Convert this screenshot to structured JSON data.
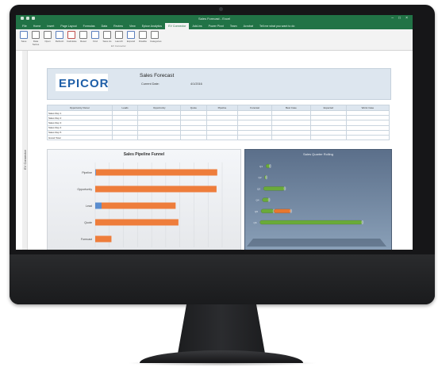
{
  "window": {
    "title": "Sales Forecast - Excel"
  },
  "ribbon": {
    "tabs": [
      "File",
      "Home",
      "Insert",
      "Page Layout",
      "Formulas",
      "Data",
      "Review",
      "View",
      "Epicor Analytics",
      "EV Connector",
      "Add-ins",
      "Power Pivot",
      "Team",
      "Acrobat",
      "Tell me what you want to do"
    ],
    "active_tab": "EV Connector",
    "buttons": [
      "Save",
      "Data Series",
      "Open",
      "Refresh",
      "Calculate",
      "Reset",
      "Find",
      "Save As",
      "Launch",
      "Expand",
      "Disable",
      "Categories"
    ],
    "group_label": "EV Connector"
  },
  "sidebar_label": "EV Connector",
  "report": {
    "logo": "EPICOR",
    "title": "Sales Forecast",
    "subtitle": "Current Date:",
    "date": "4/1/2016"
  },
  "table": {
    "headers": [
      "Opportunity Owner",
      "Leads",
      "Opportunity",
      "Quote",
      "Pipeline",
      "Forecast",
      "Best Case",
      "Expected",
      "Worst Case"
    ],
    "rows": [
      [
        "Sales Rep 1",
        "",
        "",
        "",
        "",
        "",
        "",
        "",
        ""
      ],
      [
        "Sales Rep 2",
        "",
        "",
        "",
        "",
        "",
        "",
        "",
        ""
      ],
      [
        "Sales Rep 3",
        "",
        "",
        "",
        "",
        "",
        "",
        "",
        ""
      ],
      [
        "Sales Rep 4",
        "",
        "",
        "",
        "",
        "",
        "",
        "",
        ""
      ],
      [
        "Sales Rep 5",
        "",
        "",
        "",
        "",
        "",
        "",
        "",
        ""
      ],
      [
        "Grand Total",
        "",
        "",
        "",
        "",
        "",
        "",
        "",
        ""
      ]
    ]
  },
  "charts": {
    "funnel": {
      "title": "Sales Pipeline Funnel",
      "categories": [
        "Pipeline",
        "Opportunity",
        "Lead",
        "Quote",
        "Forecast"
      ],
      "series": [
        {
          "values": [
            1,
            0,
            9,
            0,
            0
          ]
        },
        {
          "values": [
            172,
            172,
            105,
            118,
            23
          ]
        }
      ],
      "colors": [
        "#5a8dcf",
        "#ee7d3b"
      ]
    },
    "bars3d": {
      "title": "Sales Quarter Rolling",
      "categories": [
        "Q1",
        "Q2",
        "Q3",
        "Q4",
        "Q5",
        "Q6"
      ],
      "series": [
        {
          "values": [
            5,
            2,
            25,
            8,
            15,
            120
          ]
        },
        {
          "values": [
            0,
            0,
            0,
            0,
            20,
            0
          ]
        }
      ],
      "colors": [
        "#6aaa3a",
        "#e8772e"
      ]
    }
  }
}
